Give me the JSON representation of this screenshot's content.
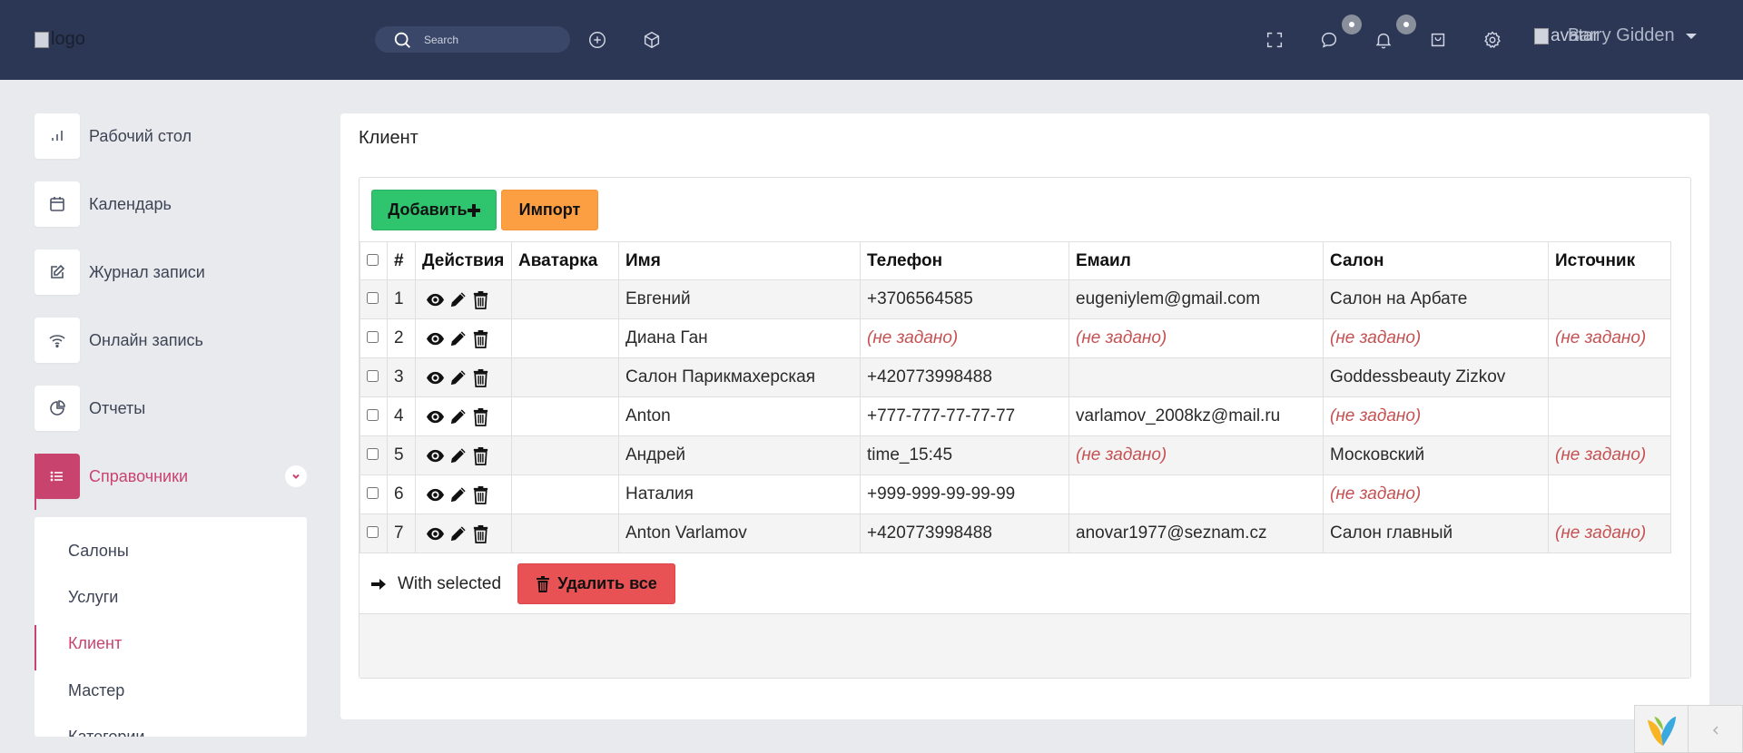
{
  "header": {
    "logo_alt": "logo",
    "search_placeholder": "Search",
    "user_avatar_alt": "avatar",
    "user_name": "Barry Gidden"
  },
  "sidebar": {
    "items": [
      {
        "label": "Рабочий стол",
        "icon": "bar-chart-icon"
      },
      {
        "label": "Календарь",
        "icon": "calendar-icon"
      },
      {
        "label": "Журнал записи",
        "icon": "edit-icon"
      },
      {
        "label": "Онлайн запись",
        "icon": "wifi-icon"
      },
      {
        "label": "Отчеты",
        "icon": "pie-chart-icon"
      },
      {
        "label": "Справочники",
        "icon": "list-icon"
      }
    ],
    "submenu": [
      {
        "label": "Салоны"
      },
      {
        "label": "Услуги"
      },
      {
        "label": "Клиент"
      },
      {
        "label": "Мастер"
      },
      {
        "label": "Категории"
      }
    ]
  },
  "main": {
    "title": "Клиент",
    "add_label": "Добавить",
    "import_label": "Импорт",
    "with_selected": "With selected",
    "delete_all_label": "Удалить все",
    "columns": [
      "#",
      "Действия",
      "Аватарка",
      "Имя",
      "Телефон",
      "Емаил",
      "Салон",
      "Источник"
    ],
    "rows": [
      {
        "n": "1",
        "avatar": "",
        "name": "Евгений",
        "phone": "+3706564585",
        "email": "eugeniylem@gmail.com",
        "salon": "Салон на Арбате",
        "source": ""
      },
      {
        "n": "2",
        "avatar": "",
        "name": "Диана Ган",
        "phone": "(не задано)",
        "email": "(не задано)",
        "salon": "(не задано)",
        "source": "(не задано)"
      },
      {
        "n": "3",
        "avatar": "",
        "name": "Салон Парикмахерская",
        "phone": "+420773998488",
        "email": "",
        "salon": "Goddessbeauty Zizkov",
        "source": ""
      },
      {
        "n": "4",
        "avatar": "",
        "name": "Anton",
        "phone": "+777-777-77-77-77",
        "email": "varlamov_2008kz@mail.ru",
        "salon": "(не задано)",
        "source": ""
      },
      {
        "n": "5",
        "avatar": "",
        "name": "Андрей",
        "phone": "time_15:45",
        "email": "(не задано)",
        "salon": "Московский",
        "source": "(не задано)"
      },
      {
        "n": "6",
        "avatar": "",
        "name": "Наталия",
        "phone": "+999-999-99-99-99",
        "email": "",
        "salon": "(не задано)",
        "source": ""
      },
      {
        "n": "7",
        "avatar": "",
        "name": "Anton Varlamov",
        "phone": "+420773998488",
        "email": "anovar1977@seznam.cz",
        "salon": "Салон главный",
        "source": "(не задано)"
      }
    ]
  },
  "colors": {
    "header_bg": "#2c3655",
    "accent": "#c9436f",
    "add_btn": "#2fc46e",
    "import_btn": "#fb9f42",
    "delete_btn": "#e85254",
    "not_set_text": "#c55152"
  }
}
